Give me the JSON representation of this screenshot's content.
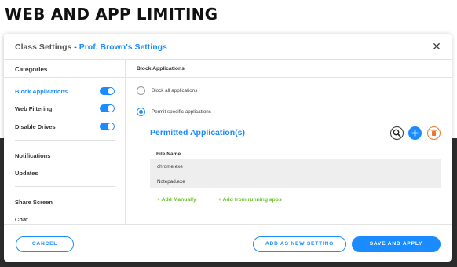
{
  "page": {
    "heading": "WEB AND APP LIMITING"
  },
  "dialog": {
    "title_prefix": "Class Settings - ",
    "title_accent": "Prof. Brown's Settings",
    "close_glyph": "✕"
  },
  "sidebar": {
    "heading": "Categories",
    "items": [
      {
        "label": "Block Applications",
        "active": true,
        "toggle": "on"
      },
      {
        "label": "Web Filtering",
        "toggle": "on"
      },
      {
        "label": "Disable Drives",
        "toggle": "on"
      },
      {
        "label": "Notifications"
      },
      {
        "label": "Updates"
      },
      {
        "label": "Share Screen"
      },
      {
        "label": "Chat"
      }
    ]
  },
  "content": {
    "heading": "Block Applications",
    "options": [
      {
        "label": "Block all applications",
        "selected": false
      },
      {
        "label": "Permit specific applications",
        "selected": true
      }
    ],
    "permitted": {
      "title": "Permitted Application(s)",
      "icons": [
        "search-icon",
        "plus-icon",
        "trash-icon"
      ],
      "column_header": "File Name",
      "rows": [
        "chrome.exe",
        "Notepad.exe"
      ]
    },
    "links": {
      "add_manually": "+ Add Manually",
      "add_running": "+ Add from running apps"
    }
  },
  "footer": {
    "cancel": "CANCEL",
    "add_new": "ADD AS NEW SETTING",
    "save": "SAVE AND APPLY"
  },
  "colors": {
    "accent": "#1a8cff",
    "link_green": "#6cc02b",
    "trash_orange": "#e9782f"
  }
}
